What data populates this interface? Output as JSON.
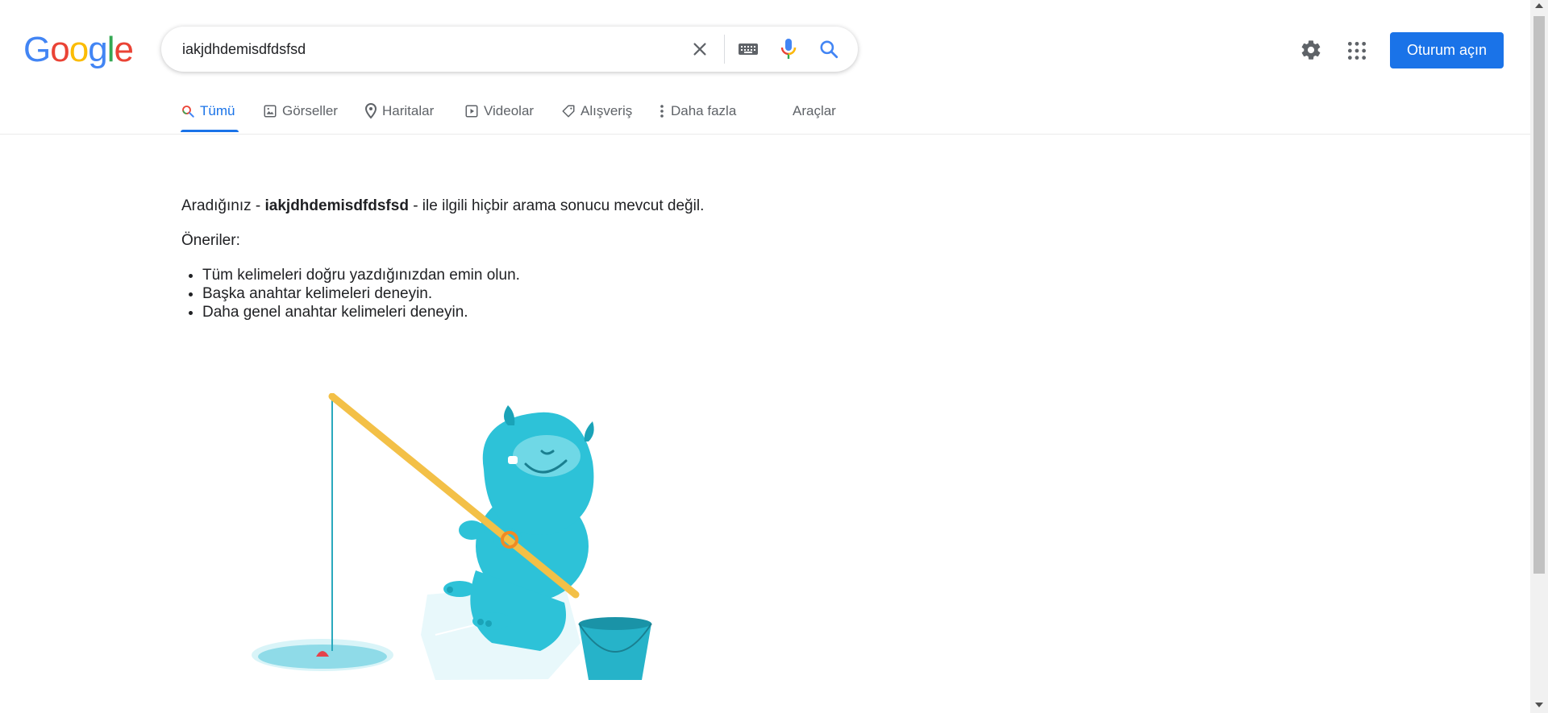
{
  "logo": {
    "letters": [
      "G",
      "o",
      "o",
      "g",
      "l",
      "e"
    ],
    "colors": [
      "#4285f4",
      "#ea4335",
      "#fbbc05",
      "#4285f4",
      "#34a853",
      "#ea4335"
    ]
  },
  "search": {
    "query": "iakjdhdemisdfdsfsd",
    "clear_icon": "close-icon",
    "keyboard_icon": "keyboard-icon",
    "voice_icon": "microphone-icon",
    "search_icon": "search-icon"
  },
  "header": {
    "signin_label": "Oturum açın",
    "settings_icon": "gear-icon",
    "apps_icon": "apps-grid-icon"
  },
  "tabs": [
    {
      "label": "Tümü",
      "icon": "search-icon",
      "active": true
    },
    {
      "label": "Görseller",
      "icon": "image-icon"
    },
    {
      "label": "Haritalar",
      "icon": "map-pin-icon"
    },
    {
      "label": "Videolar",
      "icon": "play-icon"
    },
    {
      "label": "Alışveriş",
      "icon": "tag-icon"
    },
    {
      "label": "Daha fazla",
      "icon": "more-vert-icon"
    },
    {
      "label": "Araçlar"
    }
  ],
  "results": {
    "no_results_prefix": "Aradığınız - ",
    "no_results_query": "iakjdhdemisdfdsfsd",
    "no_results_suffix": " - ile ilgili hiçbir arama sonucu mevcut değil.",
    "suggestions_title": "Öneriler:",
    "suggestions": [
      "Tüm kelimeleri doğru yazdığınızdan emin olun.",
      "Başka anahtar kelimeleri deneyin.",
      "Daha genel anahtar kelimeleri deneyin."
    ]
  },
  "colors": {
    "accent": "#1a73e8",
    "text": "#202124",
    "muted": "#5f6368",
    "yeti": "#2dc2d8"
  }
}
